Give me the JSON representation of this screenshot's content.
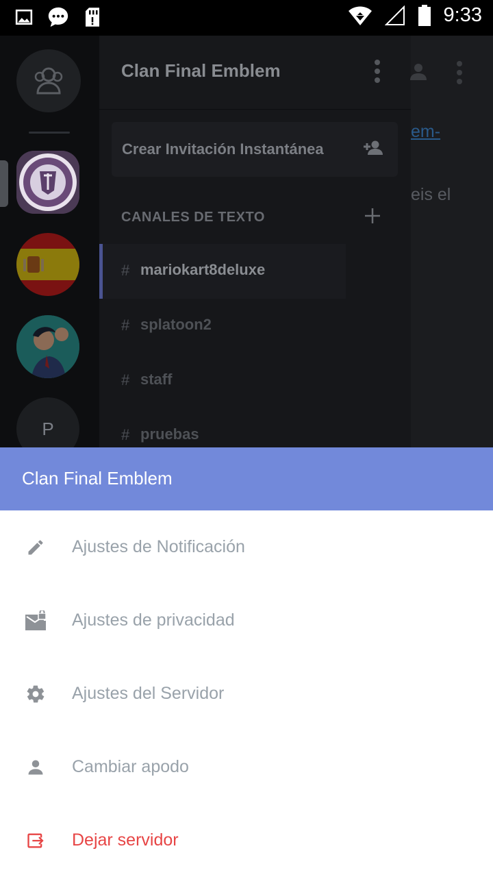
{
  "status_bar": {
    "time": "9:33",
    "left_icons": [
      "image-icon",
      "message-icon",
      "sd-card-icon"
    ],
    "right_icons": [
      "wifi-icon",
      "cell-signal-icon",
      "battery-icon"
    ]
  },
  "background_app": {
    "server_rail": {
      "servers": [
        {
          "name": "final-emblem-server",
          "icon": "final-emblem-logo"
        },
        {
          "name": "spain-server",
          "icon": "spain-flag"
        },
        {
          "name": "phoenix-server",
          "icon": "anime-character-avatar"
        },
        {
          "name": "p-server",
          "initial": "P"
        }
      ]
    },
    "channel_panel": {
      "server_title": "Clan Final Emblem",
      "invite_label": "Crear Invitación Instantánea",
      "text_channels_header": "CANALES DE TEXTO",
      "channels": [
        {
          "name": "mariokart8deluxe",
          "active": true
        },
        {
          "name": "splatoon2",
          "active": false
        },
        {
          "name": "staff",
          "active": false
        },
        {
          "name": "pruebas",
          "active": false
        }
      ],
      "hash": "#"
    },
    "chat_peek": {
      "link_fragment": "em-",
      "text_fragment": "eis el"
    }
  },
  "sheet": {
    "title": "Clan Final Emblem",
    "header_color": "#7289da",
    "items": [
      {
        "label": "Ajustes de Notificación",
        "icon": "pencil-icon"
      },
      {
        "label": "Ajustes de privacidad",
        "icon": "mail-lock-icon"
      },
      {
        "label": "Ajustes del Servidor",
        "icon": "gear-icon"
      },
      {
        "label": "Cambiar apodo",
        "icon": "person-icon"
      },
      {
        "label": "Dejar servidor",
        "icon": "exit-icon",
        "danger": true,
        "color": "#e74545"
      }
    ]
  }
}
